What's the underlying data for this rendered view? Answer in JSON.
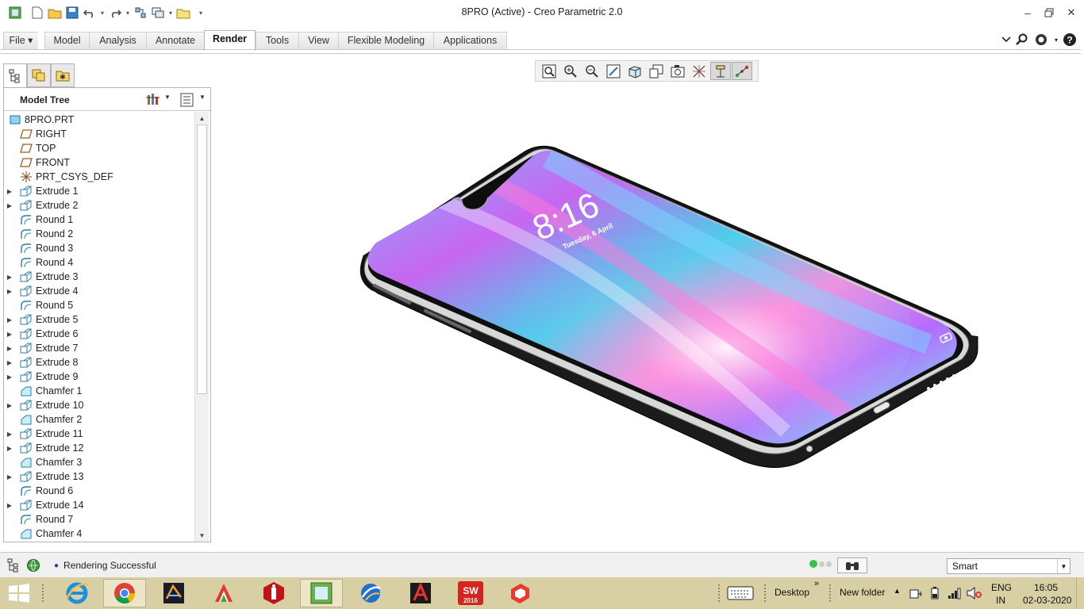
{
  "window": {
    "title": "8PRO (Active) - Creo Parametric 2.0"
  },
  "ribbon": {
    "tabs": [
      {
        "label": "File ▾"
      },
      {
        "label": "Model"
      },
      {
        "label": "Analysis"
      },
      {
        "label": "Annotate"
      },
      {
        "label": "Render",
        "active": true
      },
      {
        "label": "Tools"
      },
      {
        "label": "View"
      },
      {
        "label": "Flexible Modeling"
      },
      {
        "label": "Applications"
      }
    ]
  },
  "model_tree": {
    "title": "Model Tree",
    "items": [
      {
        "label": "8PRO.PRT",
        "icon": "part-icon",
        "expandable": false
      },
      {
        "label": "RIGHT",
        "icon": "datum-plane-icon",
        "expandable": false
      },
      {
        "label": "TOP",
        "icon": "datum-plane-icon",
        "expandable": false
      },
      {
        "label": "FRONT",
        "icon": "datum-plane-icon",
        "expandable": false
      },
      {
        "label": "PRT_CSYS_DEF",
        "icon": "csys-icon",
        "expandable": false
      },
      {
        "label": "Extrude 1",
        "icon": "extrude-icon",
        "expandable": true
      },
      {
        "label": "Extrude 2",
        "icon": "extrude-icon",
        "expandable": true
      },
      {
        "label": "Round 1",
        "icon": "round-icon",
        "expandable": false
      },
      {
        "label": "Round 2",
        "icon": "round-icon",
        "expandable": false
      },
      {
        "label": "Round 3",
        "icon": "round-icon",
        "expandable": false
      },
      {
        "label": "Round 4",
        "icon": "round-icon",
        "expandable": false
      },
      {
        "label": "Extrude 3",
        "icon": "extrude-icon",
        "expandable": true
      },
      {
        "label": "Extrude 4",
        "icon": "extrude-icon",
        "expandable": true
      },
      {
        "label": "Round 5",
        "icon": "round-icon",
        "expandable": false
      },
      {
        "label": "Extrude 5",
        "icon": "extrude-icon",
        "expandable": true
      },
      {
        "label": "Extrude 6",
        "icon": "extrude-icon",
        "expandable": true
      },
      {
        "label": "Extrude 7",
        "icon": "extrude-icon",
        "expandable": true
      },
      {
        "label": "Extrude 8",
        "icon": "extrude-icon",
        "expandable": true
      },
      {
        "label": "Extrude 9",
        "icon": "extrude-icon",
        "expandable": true
      },
      {
        "label": "Chamfer 1",
        "icon": "chamfer-icon",
        "expandable": false
      },
      {
        "label": "Extrude 10",
        "icon": "extrude-icon",
        "expandable": true
      },
      {
        "label": "Chamfer 2",
        "icon": "chamfer-icon",
        "expandable": false
      },
      {
        "label": "Extrude 11",
        "icon": "extrude-icon",
        "expandable": true
      },
      {
        "label": "Extrude 12",
        "icon": "extrude-icon",
        "expandable": true
      },
      {
        "label": "Chamfer 3",
        "icon": "chamfer-icon",
        "expandable": false
      },
      {
        "label": "Extrude 13",
        "icon": "extrude-icon",
        "expandable": true
      },
      {
        "label": "Round 6",
        "icon": "round-icon",
        "expandable": false
      },
      {
        "label": "Extrude 14",
        "icon": "extrude-icon",
        "expandable": true
      },
      {
        "label": "Round 7",
        "icon": "round-icon",
        "expandable": false
      },
      {
        "label": "Chamfer 4",
        "icon": "chamfer-icon",
        "expandable": false
      }
    ]
  },
  "phone_screen": {
    "time": "8:16",
    "date": "Tuesday, 6 April"
  },
  "statusbar": {
    "message": "Rendering Successful",
    "filter": "Smart"
  },
  "taskbar": {
    "desktop_label": "Desktop",
    "folder_label": "New folder",
    "language": "ENG",
    "region": "IN",
    "time": "16:05",
    "date": "02-03-2020",
    "solidworks_year": "2016"
  },
  "colors": {
    "taskbar": "#d8cfa4",
    "accent": "#1f6fb2"
  }
}
